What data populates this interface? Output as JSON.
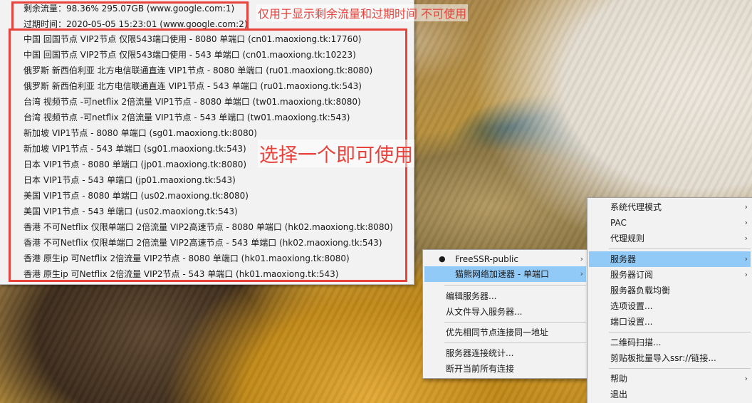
{
  "quota": {
    "remaining": "剩余流量：98.36% 295.07GB (www.google.com:1)",
    "expiry": "过期时间：2020-05-05 15:23:01 (www.google.com:2)"
  },
  "servers": [
    "中国 回国节点 VIP2节点 仅限543端口使用 - 8080 单端口 (cn01.maoxiong.tk:17760)",
    "中国 回国节点 VIP2节点 仅限543端口使用 - 543 单端口 (cn01.maoxiong.tk:10223)",
    "俄罗斯 新西伯利亚 北方电信联通直连 VIP1节点 - 8080 单端口 (ru01.maoxiong.tk:8080)",
    "俄罗斯 新西伯利亚 北方电信联通直连 VIP1节点 - 543 单端口 (ru01.maoxiong.tk:543)",
    "台湾 视频节点 -可netflix 2倍流量  VIP1节点 - 8080 单端口 (tw01.maoxiong.tk:8080)",
    "台湾 视频节点 -可netflix 2倍流量  VIP1节点 - 543 单端口 (tw01.maoxiong.tk:543)",
    "新加坡 VIP1节点 - 8080 单端口 (sg01.maoxiong.tk:8080)",
    "新加坡 VIP1节点 - 543 单端口 (sg01.maoxiong.tk:543)",
    "日本 VIP1节点 - 8080 单端口 (jp01.maoxiong.tk:8080)",
    "日本 VIP1节点 - 543 单端口 (jp01.maoxiong.tk:543)",
    "美国 VIP1节点 - 8080 单端口 (us02.maoxiong.tk:8080)",
    "美国 VIP1节点 - 543 单端口 (us02.maoxiong.tk:543)",
    "香港 不可Netflix 仅限单端口 2倍流量 VIP2高速节点 - 8080 单端口 (hk02.maoxiong.tk:8080)",
    "香港 不可Netflix 仅限单端口 2倍流量 VIP2高速节点 - 543 单端口 (hk02.maoxiong.tk:543)",
    "香港 原生ip 可Netflix 2倍流量 VIP2节点 - 8080 单端口 (hk01.maoxiong.tk:8080)",
    "香港 原生ip 可Netflix 2倍流量 VIP2节点 - 543 单端口 (hk01.maoxiong.tk:543)"
  ],
  "annotations": {
    "info_only": "仅用于显示剩余流量和过期时间 不可使用",
    "choose_one": "选择一个即可使用"
  },
  "server_submenu": {
    "groups": [
      "FreeSSR-public",
      "猫熊网络加速器 - 单端口"
    ],
    "bullet": "●",
    "edit_servers": "编辑服务器...",
    "import_from_file": "从文件导入服务器...",
    "prefer_same_node": "优先相同节点连接同一地址",
    "connection_stats": "服务器连接统计...",
    "disconnect_all": "断开当前所有连接"
  },
  "main_menu": {
    "system_proxy_mode": "系统代理模式",
    "pac": "PAC",
    "proxy_rules": "代理规则",
    "servers": "服务器",
    "server_subscription": "服务器订阅",
    "load_balance": "服务器负载均衡",
    "options": "选项设置...",
    "port_settings": "端口设置...",
    "scan_qr": "二维码扫描...",
    "import_clipboard": "剪贴板批量导入ssr://链接...",
    "help": "帮助",
    "exit": "退出"
  },
  "arrow_glyph": "›",
  "colors": {
    "annotation_red": "#e8423c",
    "menu_background": "#f2f2f2",
    "menu_highlight": "#91c9f7"
  }
}
